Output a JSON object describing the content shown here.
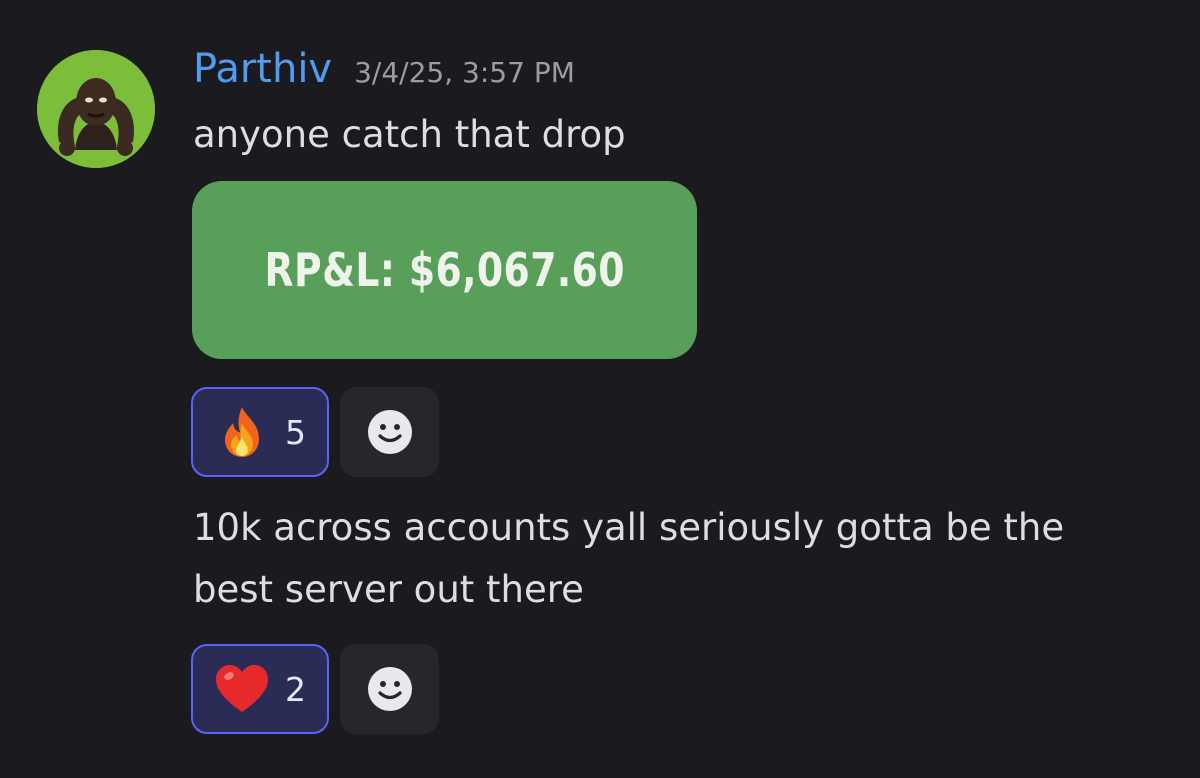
{
  "message": {
    "author": "Parthiv",
    "timestamp": "3/4/25, 3:57 PM",
    "avatar_icon": "avatar-meme-face-icon",
    "colors": {
      "background": "#1b1b1f",
      "username": "#4f9cf0",
      "reaction_bg": "#2a2c56",
      "reaction_border": "#5865f2",
      "image_bg": "#58a05a"
    },
    "first": {
      "text": "anyone catch that drop",
      "image_text": "RP&L: $6,067.60",
      "reactions": [
        {
          "emoji": "fire-emoji",
          "count": "5"
        }
      ],
      "add_reaction_icon": "smiley-add-reaction-icon"
    },
    "second": {
      "text_line1": "10k across accounts yall seriously gotta be the",
      "text_line2": "best server out there",
      "reactions": [
        {
          "emoji": "red-heart-emoji",
          "count": "2"
        }
      ],
      "add_reaction_icon": "smiley-add-reaction-icon"
    }
  }
}
